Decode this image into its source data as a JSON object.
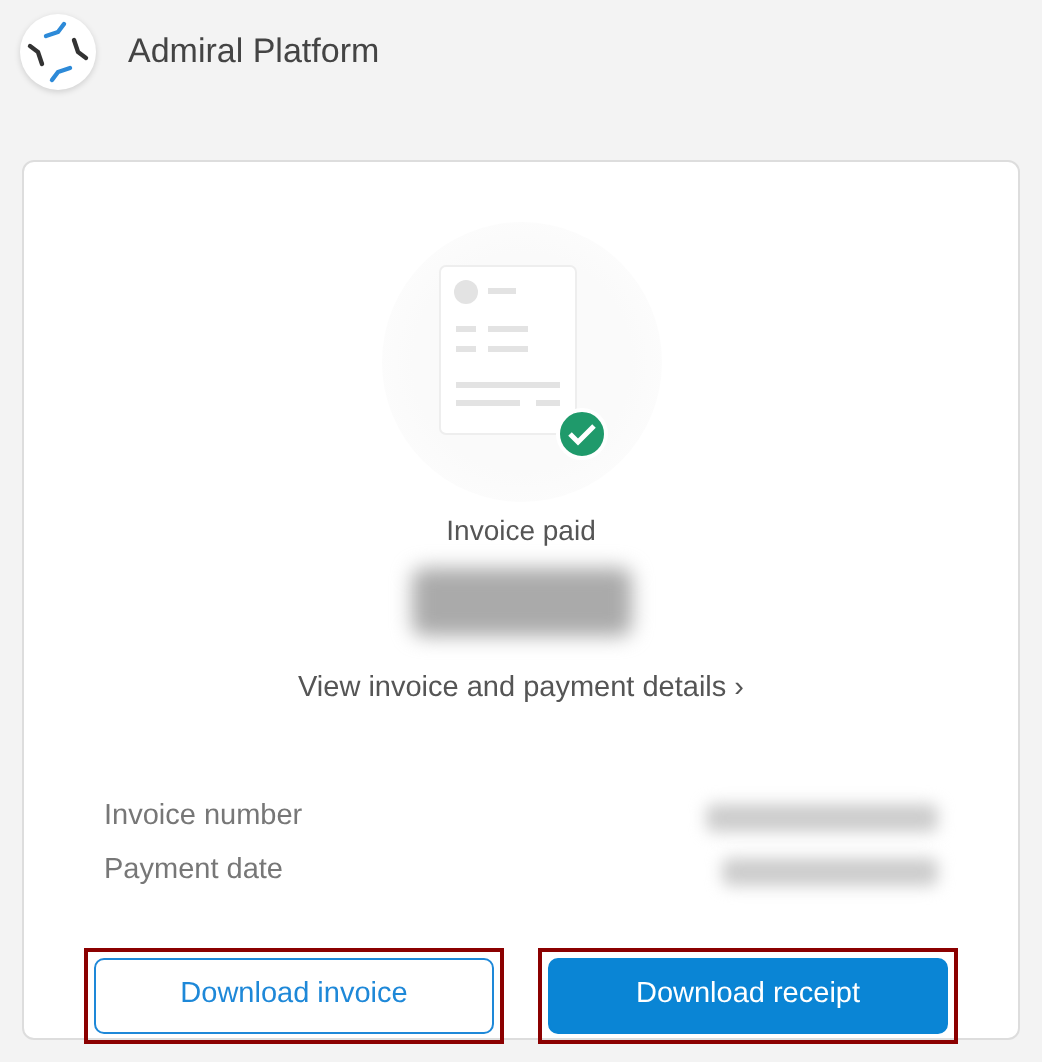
{
  "header": {
    "title": "Admiral Platform"
  },
  "status": {
    "label": "Invoice paid",
    "paid": true
  },
  "details_link": {
    "label": "View invoice and payment details",
    "chevron": "›"
  },
  "fields": [
    {
      "label": "Invoice number"
    },
    {
      "label": "Payment date"
    }
  ],
  "buttons": [
    {
      "label": "Download invoice",
      "kind": "outline",
      "highlighted": true
    },
    {
      "label": "Download receipt",
      "kind": "primary",
      "highlighted": true
    }
  ]
}
